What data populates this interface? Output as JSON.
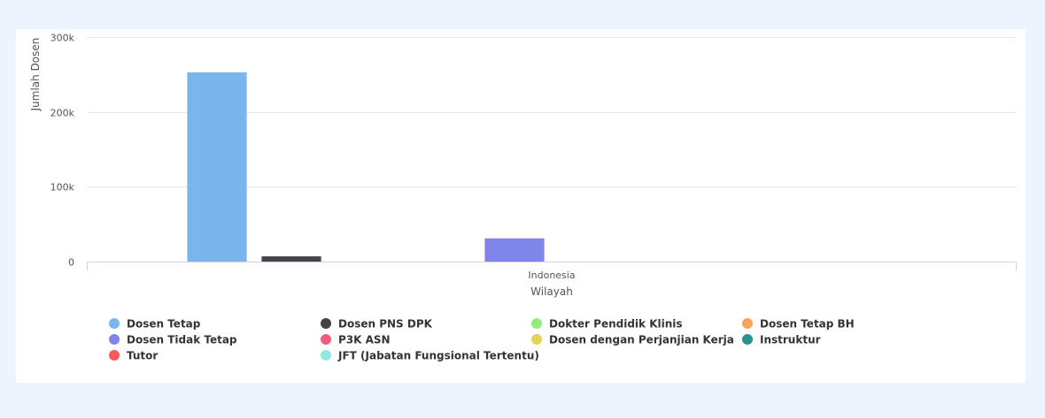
{
  "chart_data": {
    "type": "bar",
    "title": "",
    "xlabel": "Wilayah",
    "ylabel": "Jumlah Dosen",
    "categories": [
      "Indonesia"
    ],
    "ylim": [
      0,
      300000
    ],
    "yticks": [
      {
        "value": 0,
        "label": "0"
      },
      {
        "value": 100000,
        "label": "100k"
      },
      {
        "value": 200000,
        "label": "200k"
      },
      {
        "value": 300000,
        "label": "300k"
      }
    ],
    "grid": true,
    "legend_position": "bottom",
    "series": [
      {
        "name": "Dosen Tetap",
        "color": "#7cb5ec",
        "values": [
          253000
        ]
      },
      {
        "name": "Dosen PNS DPK",
        "color": "#434348",
        "values": [
          7000
        ]
      },
      {
        "name": "Dokter Pendidik Klinis",
        "color": "#90ed7d",
        "values": [
          0
        ]
      },
      {
        "name": "Dosen Tetap BH",
        "color": "#f7a35c",
        "values": [
          0
        ]
      },
      {
        "name": "Dosen Tidak Tetap",
        "color": "#8085e9",
        "values": [
          31000
        ]
      },
      {
        "name": "P3K ASN",
        "color": "#f15c80",
        "values": [
          0
        ]
      },
      {
        "name": "Dosen dengan Perjanjian Kerja",
        "color": "#e4d354",
        "values": [
          0
        ]
      },
      {
        "name": "Instruktur",
        "color": "#2b908f",
        "values": [
          0
        ]
      },
      {
        "name": "Tutor",
        "color": "#f45b5b",
        "values": [
          0
        ]
      },
      {
        "name": "JFT (Jabatan Fungsional Tertentu)",
        "color": "#91e8e1",
        "values": [
          0
        ]
      }
    ]
  }
}
